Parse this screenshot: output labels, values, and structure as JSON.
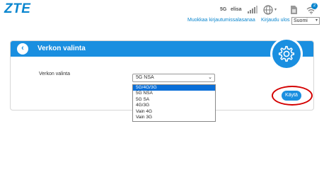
{
  "header": {
    "logo": "ZTE",
    "network_type": "5G",
    "operator": "elisa",
    "wifi_badge": "2",
    "change_password_link": "Muokkaa kirjautumissalasanaa",
    "logout_link": "Kirjaudu ulos",
    "language": "Suomi"
  },
  "panel": {
    "title": "Verkon valinta",
    "field_label": "Verkon valinta",
    "selected_value": "5G NSA",
    "options": [
      "5G/4G/3G",
      "5G NSA",
      "5G SA",
      "4G/3G",
      "Vain 4G",
      "Vain 3G"
    ],
    "highlighted_option": "5G/4G/3G",
    "apply_label": "Käytä"
  },
  "colors": {
    "brand": "#0a86cf",
    "header_bar": "#1a8fe0",
    "option_highlight": "#0a6fd8",
    "annotation_ring": "#d40000"
  },
  "icons": [
    "back-arrow-icon",
    "gear-icon",
    "signal-icon",
    "globe-icon",
    "sim-card-icon",
    "wifi-icon"
  ]
}
